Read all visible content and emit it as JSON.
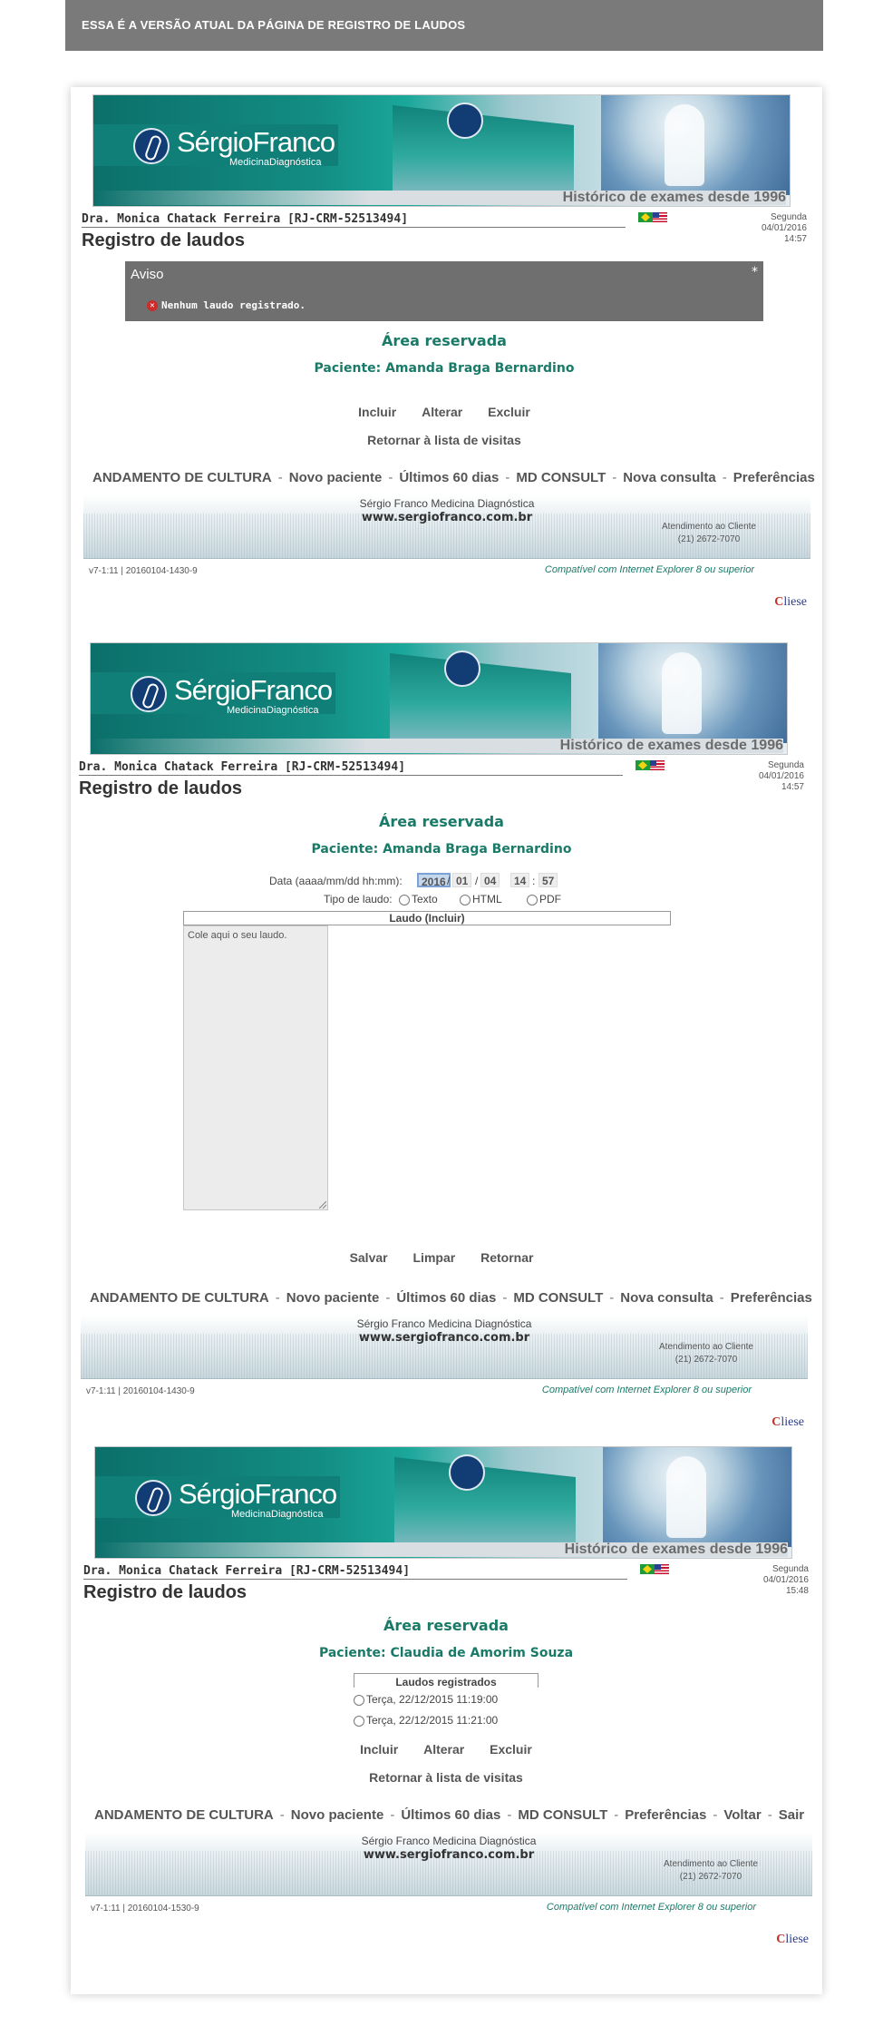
{
  "header": {
    "notice": "ESSA É A VERSÃO ATUAL DA PÁGINA DE REGISTRO DE LAUDOS"
  },
  "banner": {
    "brand": "SérgioFranco",
    "brand_sub": "MedicinaDiagnóstica",
    "history": "Histórico de exames desde 1996"
  },
  "common": {
    "doctor": "Dra. Monica Chatack Ferreira [RJ-CRM-52513494]",
    "page_title": "Registro de laudos",
    "area_title": "Área reservada",
    "menu": [
      "ANDAMENTO DE CULTURA",
      "Novo paciente",
      "Últimos 60 dias",
      "MD CONSULT",
      "Nova consulta",
      "Preferências",
      "Voltar",
      "Sair"
    ],
    "menu_sep": "-",
    "footer_company": "Sérgio Franco Medicina Diagnóstica",
    "footer_url": "www.sergiofranco.com.br",
    "footer_att_label": "Atendimento ao Cliente",
    "footer_phone": "(21) 2672-7070",
    "compat": "Compatível com Internet Explorer 8 ou superior",
    "cliese": "Cliese",
    "cliese_mark": "C",
    "cliese_rest": "liese",
    "patient_prefix": "Paciente: "
  },
  "shot1": {
    "weekday": "Segunda",
    "date": "04/01/2016",
    "time": "14:57",
    "aviso_title": "Aviso",
    "aviso_close": "*",
    "aviso_msg": "Nenhum laudo registrado.",
    "patient": "Paciente: Amanda Braga Bernardino",
    "actions": [
      "Incluir",
      "Alterar",
      "Excluir"
    ],
    "return": "Retornar à lista de visitas",
    "version": "v7-1:11 | 20160104-1430-9"
  },
  "shot2": {
    "weekday": "Segunda",
    "date": "04/01/2016",
    "time": "14:57",
    "patient": "Paciente: Amanda Braga Bernardino",
    "date_label": "Data (aaaa/mm/dd hh:mm):",
    "year": "2016",
    "month": "01",
    "day": "04",
    "hour": "14",
    "minute": "57",
    "sep_slash": "/",
    "sep_colon": ":",
    "tipo_label": "Tipo de laudo:",
    "tipo_options": [
      "Texto",
      "HTML",
      "PDF"
    ],
    "laudo_head": "Laudo (Incluir)",
    "textarea_placeholder": "Cole aqui o seu laudo.",
    "buttons": [
      "Salvar",
      "Limpar",
      "Retornar"
    ],
    "version": "v7-1:11 | 20160104-1430-9"
  },
  "shot3": {
    "weekday": "Segunda",
    "date": "04/01/2016",
    "time": "15:48",
    "patient": "Paciente: Claudia de Amorim Souza",
    "laudos_head": "Laudos registrados",
    "laudos": [
      "Terça, 22/12/2015 11:19:00",
      "Terça, 22/12/2015 11:21:00"
    ],
    "actions": [
      "Incluir",
      "Alterar",
      "Excluir"
    ],
    "return": "Retornar à lista de visitas",
    "version": "v7-1:11 | 20160104-1530-9"
  }
}
